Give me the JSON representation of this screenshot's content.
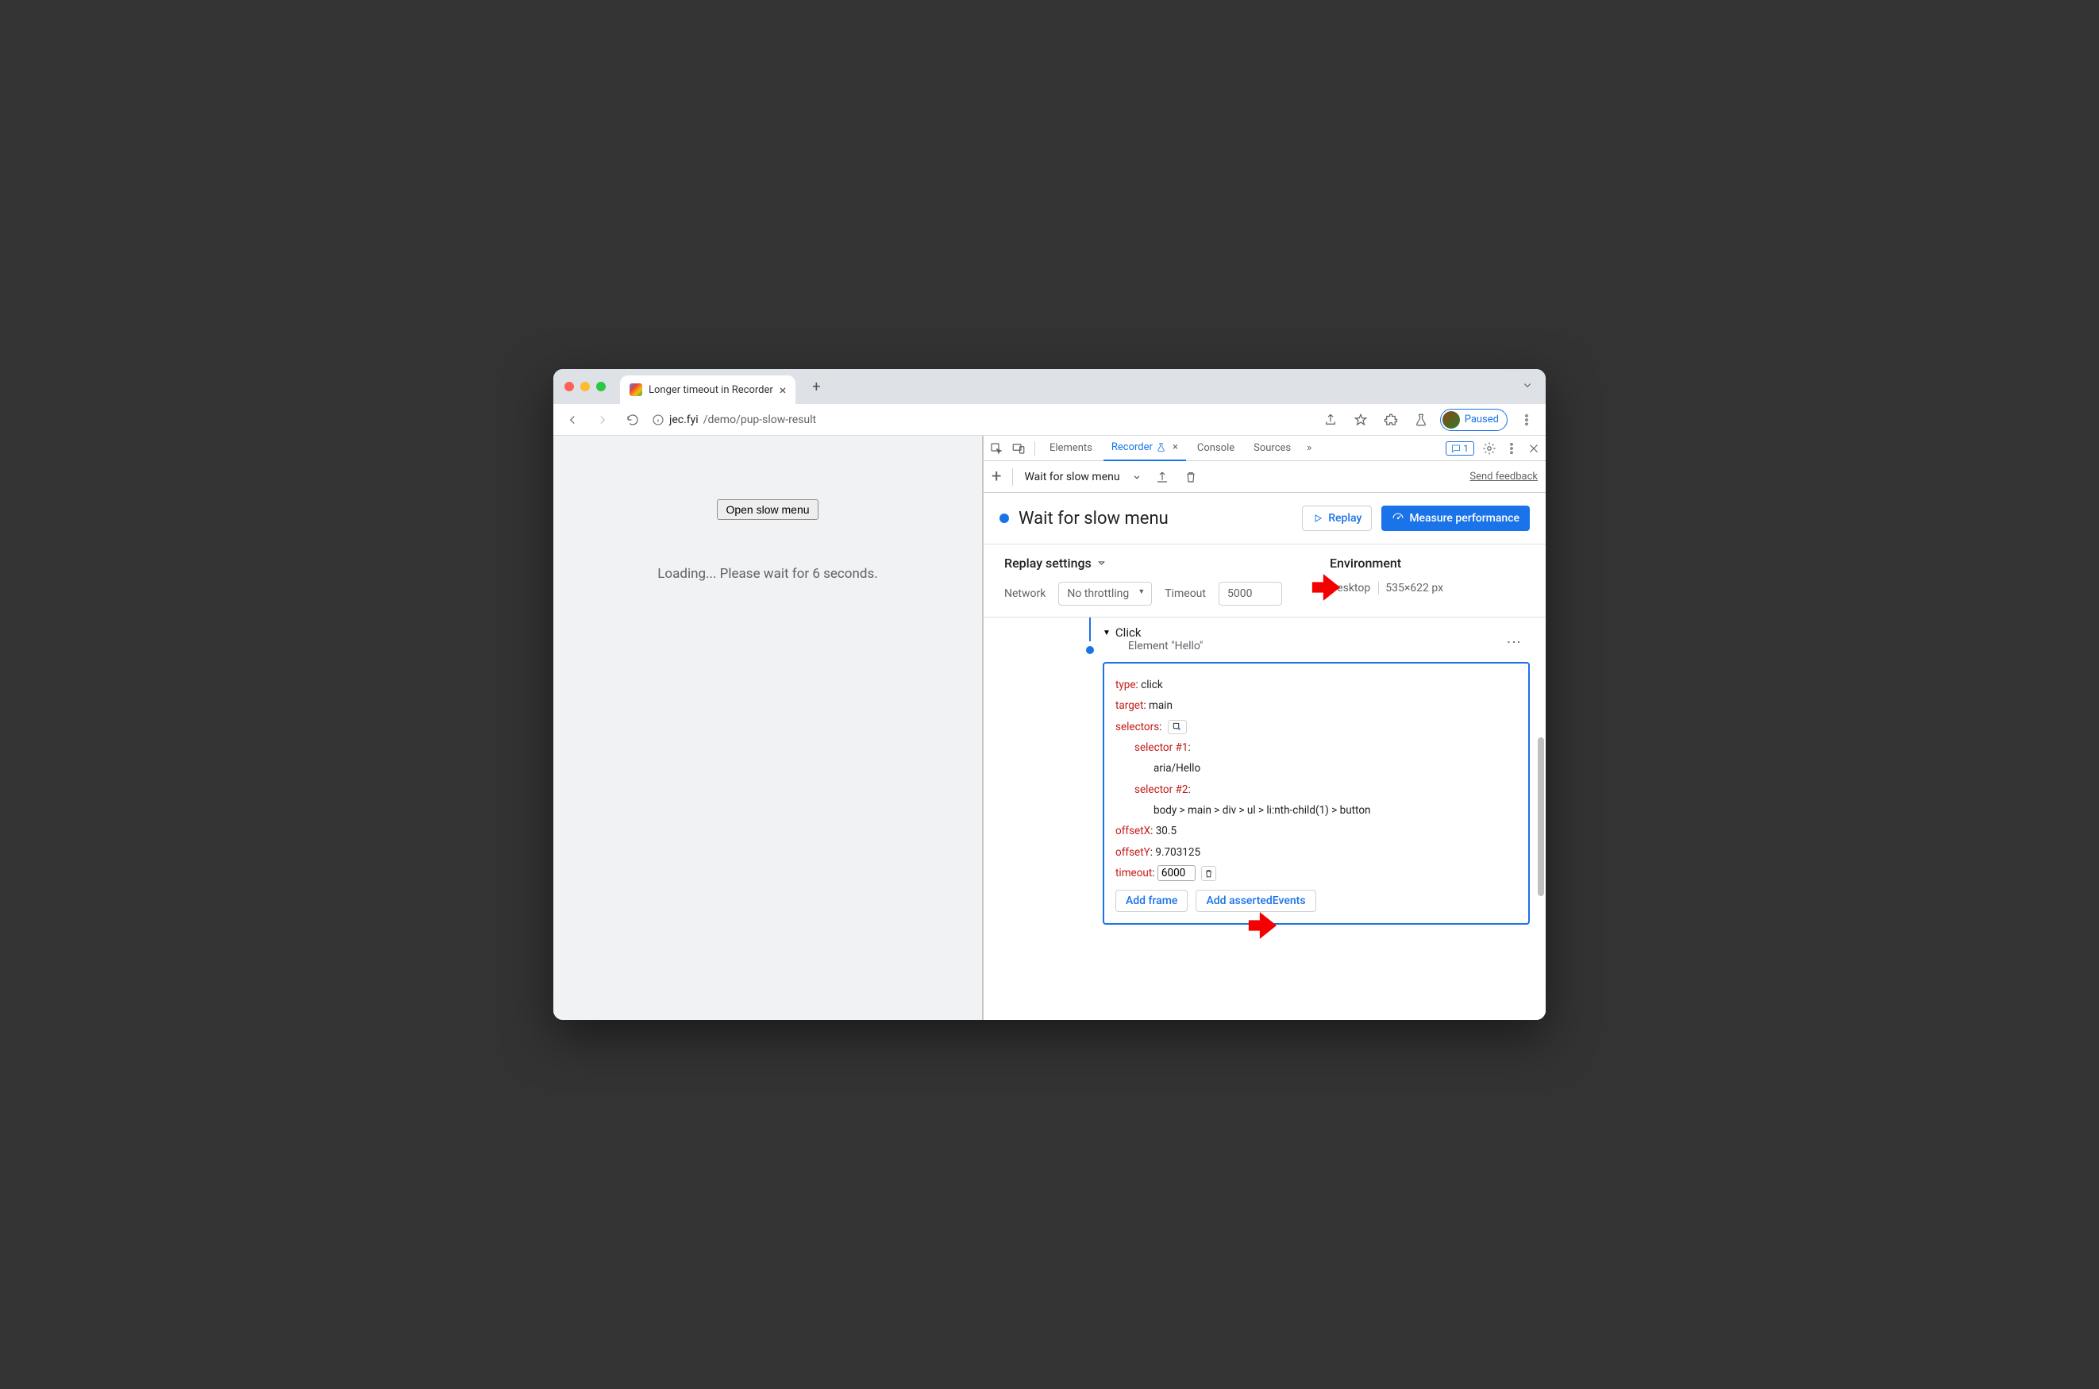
{
  "tab": {
    "title": "Longer timeout in Recorder"
  },
  "url": {
    "domain": "jec.fyi",
    "path": "/demo/pup-slow-result"
  },
  "toolbar": {
    "paused": "Paused"
  },
  "page": {
    "button": "Open slow menu",
    "loading": "Loading... Please wait for 6 seconds."
  },
  "devtools_tabs": {
    "elements": "Elements",
    "recorder": "Recorder",
    "console": "Console",
    "sources": "Sources",
    "badge": "1"
  },
  "rec_toolbar": {
    "flow": "Wait for slow menu",
    "feedback": "Send feedback"
  },
  "rec_header": {
    "title": "Wait for slow menu",
    "replay": "Replay",
    "measure": "Measure performance"
  },
  "settings": {
    "replay_title": "Replay settings",
    "network_label": "Network",
    "network_value": "No throttling",
    "timeout_label": "Timeout",
    "timeout_value": "5000",
    "env_title": "Environment",
    "env_device": "Desktop",
    "env_size": "535×622 px"
  },
  "step": {
    "title": "Click",
    "subtitle": "Element \"Hello\"",
    "type_k": "type",
    "type_v": ": click",
    "target_k": "target",
    "target_v": ": main",
    "selectors_k": "selectors",
    "selectors_v": ":",
    "sel1_k": "selector #1",
    "sel1_v": ":",
    "sel1_val": "aria/Hello",
    "sel2_k": "selector #2",
    "sel2_v": ":",
    "sel2_val": "body > main > div > ul > li:nth-child(1) > button",
    "offx_k": "offsetX",
    "offx_v": ": 30.5",
    "offy_k": "offsetY",
    "offy_v": ": 9.703125",
    "timeout_k": "timeout",
    "timeout_v": ": ",
    "timeout_input": "6000",
    "add_frame": "Add frame",
    "add_asserted": "Add assertedEvents"
  }
}
